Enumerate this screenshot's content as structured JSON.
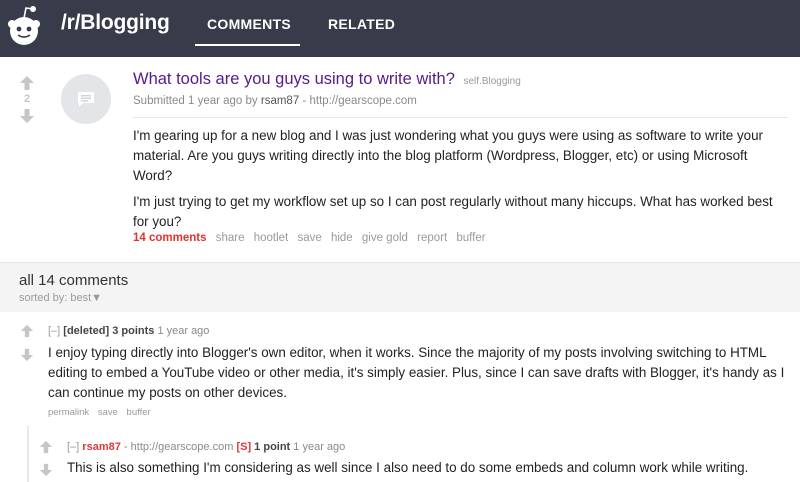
{
  "header": {
    "subreddit": "/r/Blogging",
    "tabs": [
      {
        "label": "COMMENTS",
        "active": true
      },
      {
        "label": "RELATED",
        "active": false
      }
    ]
  },
  "post": {
    "score": "2",
    "title": "What tools are you guys using to write with?",
    "domain": "self.Blogging",
    "tagline": {
      "prefix": "Submitted 1 year ago by",
      "author": "rsam87",
      "separator": "-",
      "author_site": "http://gearscope.com"
    },
    "paragraphs": [
      "I'm gearing up for a new blog and I was just wondering what you guys were using as software to write your material. Are you guys writing directly into the blog platform (Wordpress, Blogger, etc) or using Microsoft Word?",
      "I'm just trying to get my workflow set up so I can post regularly without many hiccups. What has worked best for you?"
    ],
    "actions": {
      "comments": "14 comments",
      "share": "share",
      "hootlet": "hootlet",
      "save": "save",
      "hide": "hide",
      "give_gold": "give gold",
      "report": "report",
      "buffer": "buffer"
    }
  },
  "comment_area": {
    "title": "all 14 comments",
    "sorted_label": "sorted by:",
    "sorted_value": "best",
    "sorted_arrow": "▼"
  },
  "comments": [
    {
      "expand": "[–]",
      "author": "[deleted]",
      "points": "3 points",
      "age": "1 year ago",
      "body": "I enjoy typing directly into Blogger's own editor, when it works. Since the majority of my posts involving switching to HTML editing to embed a YouTube video or other media, it's simply easier. Plus, since I can save drafts with Blogger, it's handy as I can continue my posts on other devices.",
      "actions": {
        "permalink": "permalink",
        "save": "save",
        "buffer": "buffer"
      }
    },
    {
      "expand": "[–]",
      "author": "rsam87",
      "separator": "-",
      "author_site": "http://gearscope.com",
      "flair": "[S]",
      "points": "1 point",
      "age": "1 year ago",
      "body": "This is also something I'm considering as well since I also need to do some embeds and column work while writing. Thanks for the input!"
    }
  ],
  "colors": {
    "header_bg": "#383c4a",
    "title_visited": "#551a8b",
    "comments_link": "#e0342c",
    "op_author": "#d93a3a"
  }
}
